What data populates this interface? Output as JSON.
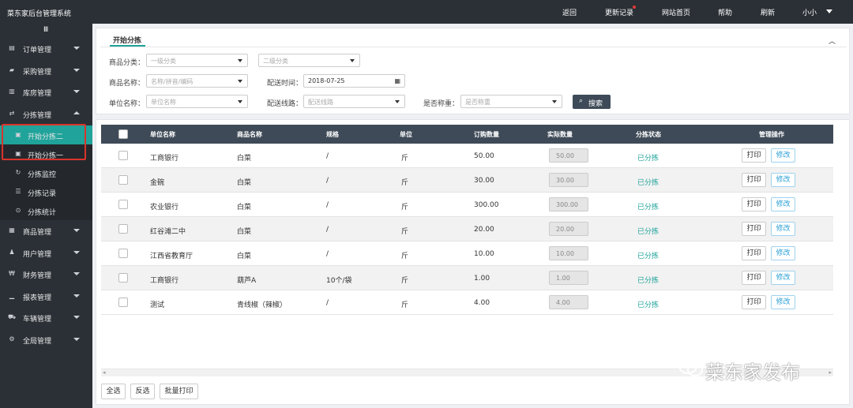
{
  "app": {
    "title": "菜东家后台管理系统"
  },
  "topnav": {
    "items": [
      "返回",
      "更新记录",
      "网站首页",
      "帮助",
      "刷新"
    ],
    "user": "小小"
  },
  "sidebar": {
    "toggle": "Ⅲ",
    "items": [
      {
        "label": "订单管理",
        "icon": "order-icon"
      },
      {
        "label": "采购管理",
        "icon": "purchase-icon"
      },
      {
        "label": "库房管理",
        "icon": "warehouse-icon"
      },
      {
        "label": "分拣管理",
        "icon": "sort-icon"
      },
      {
        "label": "商品管理",
        "icon": "goods-icon"
      },
      {
        "label": "用户管理",
        "icon": "users-icon"
      },
      {
        "label": "财务管理",
        "icon": "finance-icon"
      },
      {
        "label": "报表管理",
        "icon": "report-icon"
      },
      {
        "label": "车辆管理",
        "icon": "car-icon"
      },
      {
        "label": "全局管理",
        "icon": "global-icon"
      }
    ],
    "subitems": [
      {
        "label": "开始分拣二",
        "icon": "start-sort-icon"
      },
      {
        "label": "开始分拣一",
        "icon": "start-sort-icon"
      },
      {
        "label": "分拣监控",
        "icon": "monitor-icon"
      },
      {
        "label": "分拣记录",
        "icon": "list-icon"
      },
      {
        "label": "分拣统计",
        "icon": "stats-icon"
      }
    ]
  },
  "filter": {
    "tab": "开始分拣",
    "category_label": "商品分类：",
    "category1_placeholder": "一级分类",
    "category2_placeholder": "二级分类",
    "goods_label": "商品名称：",
    "goods_placeholder": "名称/拼音/编码",
    "date_label": "配送时间：",
    "date_value": "2018-07-25",
    "unit_label": "单位名称：",
    "unit_placeholder": "单位名称",
    "route_label": "配送线路：",
    "route_placeholder": "配送线路",
    "weigh_label": "是否称重：",
    "weigh_placeholder": "是否称重",
    "search_label": "搜索"
  },
  "table": {
    "columns": [
      "单位名称",
      "商品名称",
      "规格",
      "单位",
      "订购数量",
      "实际数量",
      "分拣状态",
      "管理操作"
    ],
    "print_label": "打印",
    "edit_label": "修改",
    "rows": [
      {
        "unit_name": "工商银行",
        "goods": "白菜",
        "spec": "/",
        "unit": "斤",
        "order_qty": "50.00",
        "actual_qty": "50.00",
        "status": "已分拣"
      },
      {
        "unit_name": "金碗",
        "goods": "白菜",
        "spec": "/",
        "unit": "斤",
        "order_qty": "30.00",
        "actual_qty": "30.00",
        "status": "已分拣"
      },
      {
        "unit_name": "农业银行",
        "goods": "白菜",
        "spec": "/",
        "unit": "斤",
        "order_qty": "300.00",
        "actual_qty": "300.00",
        "status": "已分拣"
      },
      {
        "unit_name": "红谷滩二中",
        "goods": "白菜",
        "spec": "/",
        "unit": "斤",
        "order_qty": "20.00",
        "actual_qty": "20.00",
        "status": "已分拣"
      },
      {
        "unit_name": "江西省教育厅",
        "goods": "白菜",
        "spec": "/",
        "unit": "斤",
        "order_qty": "10.00",
        "actual_qty": "10.00",
        "status": "已分拣"
      },
      {
        "unit_name": "工商银行",
        "goods": "葫芦A",
        "spec": "10个/袋",
        "unit": "斤",
        "order_qty": "1.00",
        "actual_qty": "1.00",
        "status": "已分拣"
      },
      {
        "unit_name": "测试",
        "goods": "青线椒（辣椒）",
        "spec": "/",
        "unit": "斤",
        "order_qty": "4.00",
        "actual_qty": "4.00",
        "status": "已分拣"
      }
    ]
  },
  "footer": {
    "select_all": "全选",
    "invert": "反选",
    "batch_print": "批量打印"
  },
  "watermark": "菜东家发布",
  "colors": {
    "accent": "#1fa39a",
    "dark": "#2b3036",
    "header": "#3e4a57",
    "highlight": "#d9342b"
  }
}
